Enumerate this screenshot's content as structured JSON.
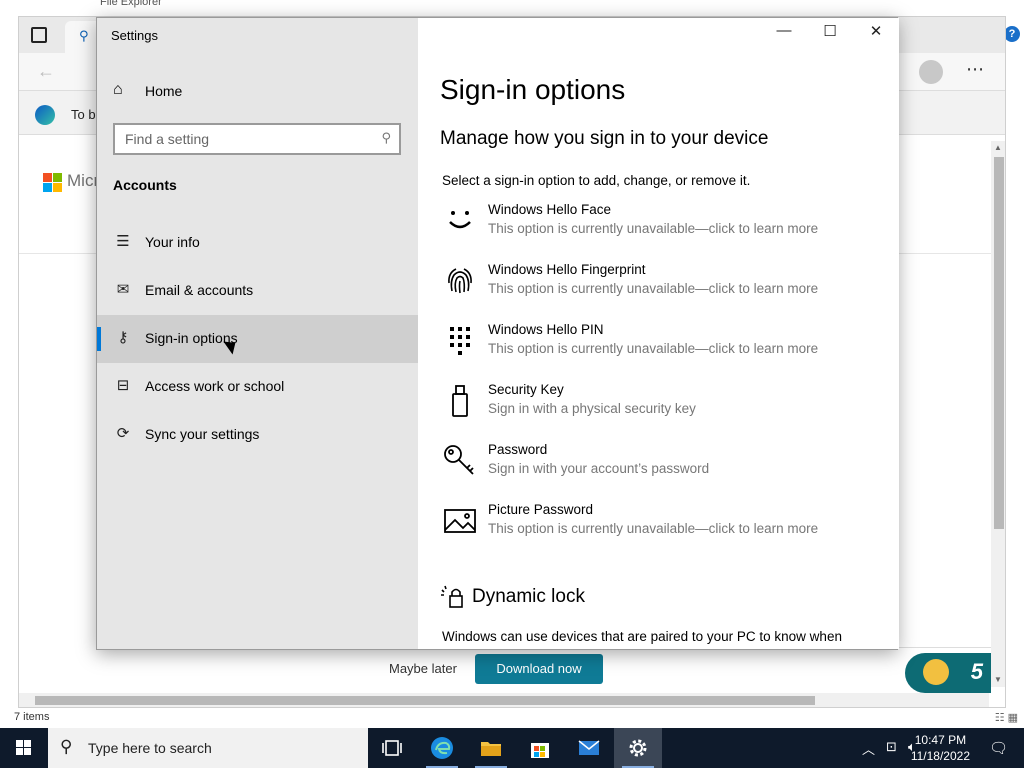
{
  "explorer": {
    "title": "File Explorer",
    "status_items": "7 items",
    "help": "?"
  },
  "edge": {
    "banner_text": "To be",
    "ms_word": "Micro",
    "maybe_later": "Maybe later",
    "download_now": "Download now",
    "badge_number": "5"
  },
  "settings": {
    "title": "Settings",
    "home_label": "Home",
    "search_placeholder": "Find a setting",
    "section_heading": "Accounts",
    "nav": [
      {
        "label": "Your info",
        "icon": "person-list-icon"
      },
      {
        "label": "Email & accounts",
        "icon": "mail-icon"
      },
      {
        "label": "Sign-in options",
        "icon": "key-icon"
      },
      {
        "label": "Access work or school",
        "icon": "briefcase-icon"
      },
      {
        "label": "Sync your settings",
        "icon": "sync-icon"
      }
    ],
    "active_nav": "Sign-in options",
    "page_title": "Sign-in options",
    "manage_heading": "Manage how you sign in to your device",
    "select_text": "Select a sign-in option to add, change, or remove it.",
    "options": [
      {
        "name": "Windows Hello Face",
        "desc": "This option is currently unavailable—click to learn more",
        "icon": "face-icon"
      },
      {
        "name": "Windows Hello Fingerprint",
        "desc": "This option is currently unavailable—click to learn more",
        "icon": "fingerprint-icon"
      },
      {
        "name": "Windows Hello PIN",
        "desc": "This option is currently unavailable—click to learn more",
        "icon": "pin-keypad-icon"
      },
      {
        "name": "Security Key",
        "desc": "Sign in with a physical security key",
        "icon": "usb-key-icon"
      },
      {
        "name": "Password",
        "desc": "Sign in with your account’s password",
        "icon": "password-key-icon"
      },
      {
        "name": "Picture Password",
        "desc": "This option is currently unavailable—click to learn more",
        "icon": "picture-icon"
      }
    ],
    "dynamic_lock_heading": "Dynamic lock",
    "dynamic_lock_text": "Windows can use devices that are paired to your PC to know when"
  },
  "taskbar": {
    "search_placeholder": "Type here to search",
    "time": "10:47 PM",
    "date": "11/18/2022"
  },
  "colors": {
    "accent": "#0078d7",
    "taskbar_bg": "#0e1a2b",
    "download_button": "#0f7b96",
    "sidebar_bg": "#e6e6e6"
  }
}
